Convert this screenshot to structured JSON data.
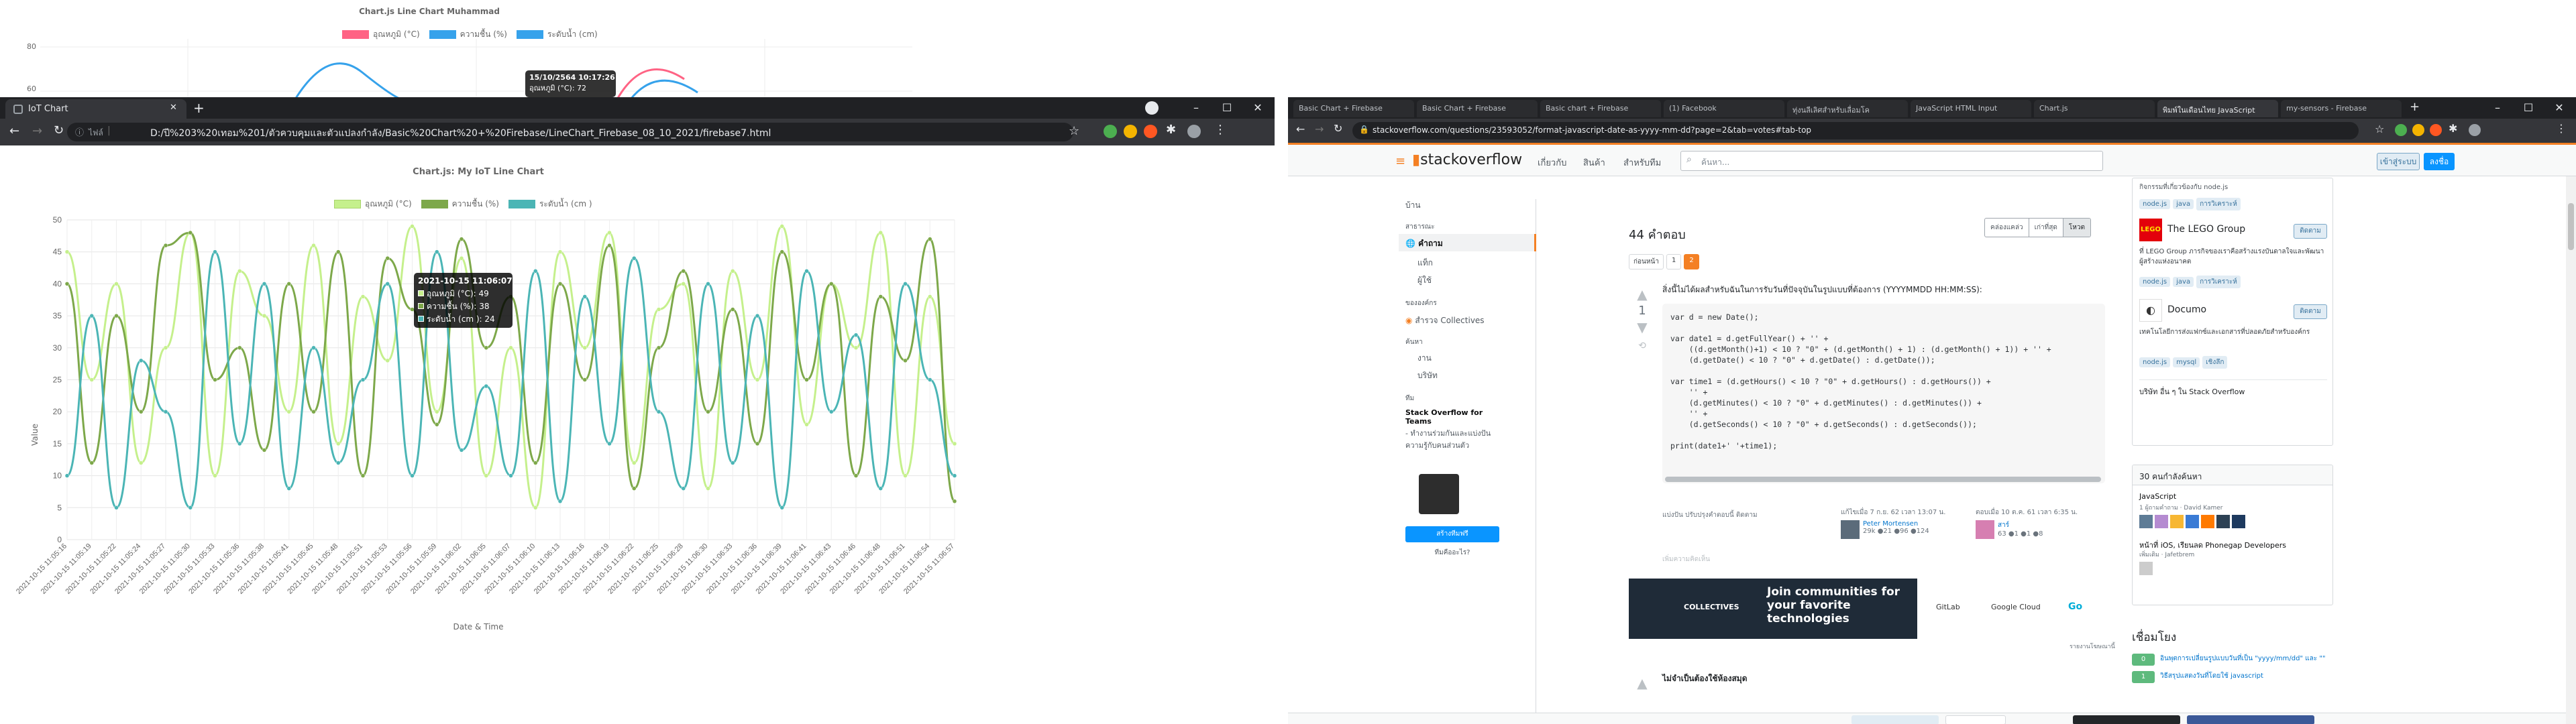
{
  "bg_chart": {
    "title": "Chart.js Line Chart Muhammad",
    "legend": [
      {
        "label": "อุณหภูมิ (°C)",
        "color": "#ff6384"
      },
      {
        "label": "ความชื้น (%)",
        "color": "#36a2eb"
      },
      {
        "label": "ระดับน้ำ (cm)",
        "color": "#36a2eb"
      }
    ],
    "yticks": [
      "80",
      "60"
    ],
    "tooltip_title": "15/10/2564 10:17:26",
    "tooltip_line": "อุณหภูมิ (°C): 72"
  },
  "left_browser": {
    "tab_title": "IoT Chart",
    "new_tab": "+",
    "info_label": "ไฟล์",
    "url": "D:/ปี%203%20เทอม%201/ตัวควบคุมและตัวแปลงกำลัง/Basic%20Chart%20+%20Firebase/LineChart_Firebase_08_10_2021/firebase7.html",
    "controls": [
      "–",
      "☐",
      "✕"
    ]
  },
  "chart_data": {
    "type": "line",
    "title": "Chart.js: My IoT Line Chart",
    "xlabel": "Date & Time",
    "ylabel": "Value",
    "ylim": [
      0,
      50
    ],
    "yticks": [
      "0",
      "5",
      "10",
      "15",
      "20",
      "25",
      "30",
      "35",
      "40",
      "45",
      "50"
    ],
    "grid": true,
    "legend_position": "top",
    "categories": [
      "2021-10-15 11:05:16",
      "2021-10-15 11:05:19",
      "2021-10-15 11:05:22",
      "2021-10-15 11:05:24",
      "2021-10-15 11:05:27",
      "2021-10-15 11:05:30",
      "2021-10-15 11:05:33",
      "2021-10-15 11:05:36",
      "2021-10-15 11:05:38",
      "2021-10-15 11:05:41",
      "2021-10-15 11:05:45",
      "2021-10-15 11:05:48",
      "2021-10-15 11:05:51",
      "2021-10-15 11:05:53",
      "2021-10-15 11:05:56",
      "2021-10-15 11:05:59",
      "2021-10-15 11:06:02",
      "2021-10-15 11:06:05",
      "2021-10-15 11:06:07",
      "2021-10-15 11:06:10",
      "2021-10-15 11:06:13",
      "2021-10-15 11:06:16",
      "2021-10-15 11:06:19",
      "2021-10-15 11:06:22",
      "2021-10-15 11:06:25",
      "2021-10-15 11:06:28",
      "2021-10-15 11:06:30",
      "2021-10-15 11:06:33",
      "2021-10-15 11:06:36",
      "2021-10-15 11:06:39",
      "2021-10-15 11:06:41",
      "2021-10-15 11:06:43",
      "2021-10-15 11:06:46",
      "2021-10-15 11:06:48",
      "2021-10-15 11:06:51",
      "2021-10-15 11:06:54",
      "2021-10-15 11:06:57"
    ],
    "series": [
      {
        "name": "อุณหภูมิ (°C)",
        "color": "#c5f08c",
        "values": [
          45,
          25,
          40,
          12,
          30,
          48,
          10,
          42,
          35,
          20,
          46,
          15,
          38,
          28,
          49,
          20,
          44,
          10,
          30,
          5,
          45,
          30,
          48,
          12,
          36,
          40,
          8,
          42,
          25,
          49,
          18,
          40,
          30,
          48,
          10,
          38,
          15
        ]
      },
      {
        "name": "ความชื้น (%)",
        "color": "#7da84a",
        "values": [
          40,
          12,
          35,
          20,
          46,
          48,
          25,
          30,
          14,
          40,
          20,
          45,
          10,
          44,
          36,
          18,
          47,
          30,
          38,
          12,
          40,
          25,
          46,
          8,
          30,
          42,
          20,
          36,
          15,
          45,
          25,
          40,
          10,
          38,
          28,
          47,
          6
        ]
      },
      {
        "name": "ระดับน้ำ (cm )",
        "color": "#4bb5b5",
        "values": [
          10,
          35,
          5,
          28,
          20,
          5,
          45,
          15,
          40,
          8,
          30,
          12,
          25,
          40,
          10,
          45,
          14,
          24,
          10,
          42,
          6,
          38,
          15,
          44,
          20,
          8,
          40,
          12,
          35,
          5,
          42,
          20,
          32,
          8,
          40,
          25,
          10
        ]
      }
    ],
    "tooltip": {
      "title": "2021-10-15 11:06:07",
      "lines": [
        "อุณหภูมิ (°C): 49",
        "ความชื้น (%): 38",
        "ระดับน้ำ (cm ): 24"
      ]
    }
  },
  "right_browser": {
    "tabs": [
      "Basic Chart + Firebase",
      "Basic Chart + Firebase",
      "Basic chart + Firebase",
      "(1) Facebook",
      "ทุ่งนลีเลิศสำหรับเลื่อมโค",
      "JavaScript HTML Input",
      "Chart.js",
      "พิมพ์ในเดือนไทย JavaScript",
      "my-sensors - Firebase"
    ],
    "url": "stackoverflow.com/questions/23593052/format-javascript-date-as-yyyy-mm-dd?page=2&tab=votes#tab-top",
    "so": {
      "logo": "stackoverflow",
      "nav": [
        "เกี่ยวกับ",
        "สินค้า",
        "สำหรับทีม"
      ],
      "search_placeholder": "ค้นหา...",
      "login": "เข้าสู่ระบบ",
      "signup": "ลงชื่อ",
      "sidebar": [
        "บ้าน",
        "สาธารณะ",
        "คำถาม",
        "แท็ก",
        "ผู้ใช้",
        "ขององค์กร",
        "สำรวจ Collectives",
        "ค้นหา",
        "งาน",
        "บริษัท",
        "ทีม"
      ],
      "teams_title": "Stack Overflow for Teams",
      "teams_text": "- ทำงานร่วมกันและแบ่งปันความรู้กับคนส่วนตัว",
      "teams_btn": "สร้างทีมฟรี",
      "teams_link": "ทีมคืออะไร?",
      "answers_count": "44 คำตอบ",
      "sort_tabs": [
        "คล่องแคล่ว",
        "เก่าที่สุด",
        "โหวต"
      ],
      "pages": [
        "ก่อนหน้า",
        "1",
        "2"
      ],
      "vote": "1",
      "answer_text": "สิ่งนี้ไม่ได้ผลสำหรับฉันในการรับวันที่ปัจจุบันในรูปแบบที่ต้องการ (YYYYMMDD HH:MM:SS):",
      "code": "var d = new Date();\n\nvar date1 = d.getFullYear() + '' +\n    ((d.getMonth()+1) < 10 ? \"0\" + (d.getMonth() + 1) : (d.getMonth() + 1)) + '' +\n    (d.getDate() < 10 ? \"0\" + d.getDate() : d.getDate());\n\nvar time1 = (d.getHours() < 10 ? \"0\" + d.getHours() : d.getHours()) +\n    '' +\n    (d.getMinutes() < 10 ? \"0\" + d.getMinutes() : d.getMinutes()) +\n    '' +\n    (d.getSeconds() < 10 ? \"0\" + d.getSeconds() : d.getSeconds());\n\nprint(date1+' '+time1);",
      "share_links": "แบ่งปัน  ปรับปรุงคำตอบนี้  ติดตาม",
      "edited": "แก้ไขเมื่อ 7 ก.ย. 62 เวลา 13:07 น.",
      "editor": "Peter Mortensen",
      "editor_rep": "29k ●21 ●96 ●124",
      "answered": "ตอบเมื่อ 10 ต.ค. 61 เวลา 6:35 น.",
      "answerer": "สาร์",
      "answerer_rep": "63 ●1 ●1 ●8",
      "add_comment": "เพิ่มความคิดเห็น",
      "ad_title": "Join communities for your favorite technologies",
      "ad_brand": "COLLECTIVES",
      "ad_partners": [
        "GitLab",
        "Google Cloud",
        "Go"
      ],
      "ad_report": "รายงานโฆษณานี้",
      "next_heading": "ไม่จำเป็นต้องใช้ห้องสมุด",
      "collectives": [
        {
          "name": "The LEGO Group",
          "btn": "ติดตาม",
          "desc": "ที่ LEGO Group ภารกิจของเราคือสร้างแรงบันดาลใจและพัฒนาผู้สร้างแห่งอนาคต",
          "tags": [
            "node.js",
            "java",
            "การวิเคราะห์"
          ]
        },
        {
          "name": "Documo",
          "btn": "ติดตาม",
          "desc": "เทคโนโลยีการส่งแฟกซ์และเอกสารที่ปลอดภัยสำหรับองค์กร",
          "tags": [
            "node.js",
            "mysql",
            "เชิงลึก"
          ]
        }
      ],
      "collective_link": "บริษัท อื่น ๆ ใน Stack Overflow",
      "tag_card_top": "กิจกรรมที่เกี่ยวข้องกับ node.js",
      "hot_title": "30 คนกำลังค้นหา",
      "hot_item1": "JavaScript",
      "hot_item1_sub": "1 ผู้ถามคำถาม · David Kamer",
      "hot_item2": "หน้าที่ iOS, เรียนลด Phonegap Developers",
      "hot_item2_sub": "เพิ่มเติม · Jafetbrem",
      "linked_title": "เชื่อมโยง",
      "linked": [
        {
          "votes": "0",
          "text": "อินพุตการเปลี่ยนรูปแบบวันที่เป็น \"yyyy/mm/dd\" และ \"\""
        },
        {
          "votes": "1",
          "text": "วิธีสรุปแสดงวันที่โดยใช้ javascript"
        }
      ]
    }
  }
}
